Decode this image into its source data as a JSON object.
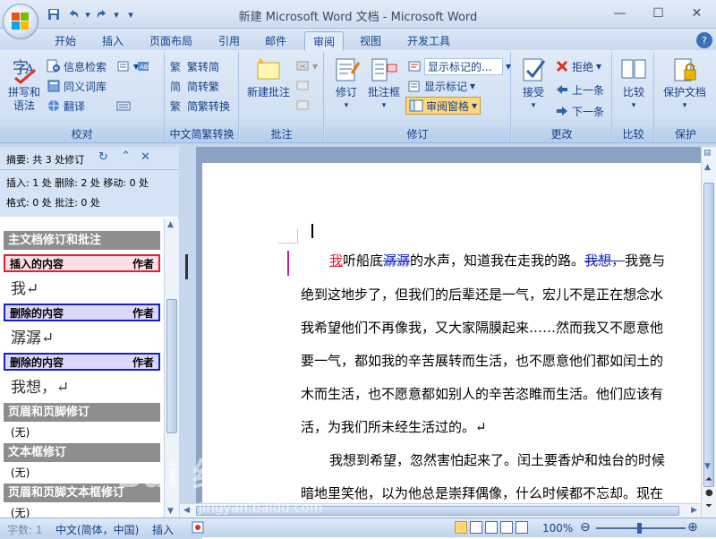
{
  "window": {
    "title": "新建 Microsoft Word 文档 - Microsoft Word",
    "quick_access": [
      "save-icon",
      "undo-icon",
      "redo-icon",
      "customize-icon"
    ]
  },
  "tabs": [
    {
      "label": "开始"
    },
    {
      "label": "插入"
    },
    {
      "label": "页面布局"
    },
    {
      "label": "引用"
    },
    {
      "label": "邮件"
    },
    {
      "label": "审阅",
      "active": true
    },
    {
      "label": "视图"
    },
    {
      "label": "开发工具"
    }
  ],
  "ribbon": {
    "proofing": {
      "label": "校对",
      "spell_check": "拼写和\n语法",
      "research": "信息检索",
      "thesaurus": "同义词库",
      "translate": "翻译"
    },
    "chinese_conversion": {
      "label": "中文简繁转换",
      "to_traditional": "繁转简",
      "to_simplified": "简转繁",
      "conversion": "简繁转换"
    },
    "comments": {
      "label": "批注",
      "new_comment": "新建批注"
    },
    "tracking": {
      "label": "修订",
      "track_changes": "修订",
      "balloons": "批注框",
      "display_for_review": "显示标记的...",
      "show_markup": "显示标记",
      "reviewing_pane": "审阅窗格"
    },
    "changes": {
      "label": "更改",
      "accept": "接受",
      "reject": "拒绝",
      "previous": "上一条",
      "next": "下一条"
    },
    "compare": {
      "label": "比较",
      "compare": "比较"
    },
    "protect": {
      "label": "保护",
      "protect_document": "保护文档"
    }
  },
  "pane": {
    "summary": "摘要: 共 3 处修订",
    "stats_line1": "插入: 1 处  删除: 2 处  移动: 0 处",
    "stats_line2": "格式: 0 处  批注: 0 处",
    "main_section": "主文档修订和批注",
    "revisions": [
      {
        "type": "插入的内容",
        "author": "作者",
        "text": "我↵"
      },
      {
        "type": "删除的内容",
        "author": "作者",
        "text": "潺潺↵"
      },
      {
        "type": "删除的内容",
        "author": "作者",
        "text": "我想，↵"
      }
    ],
    "header_footer": "页眉和页脚修订",
    "header_footer_value": "(无)",
    "textbox": "文本框修订",
    "textbox_value": "(无)",
    "header_footer_textbox": "页眉和页脚文本框修订",
    "header_footer_textbox_value": "(无)"
  },
  "document": {
    "line1_ins": "我",
    "line1_a": "听船底",
    "line1_del": "潺潺",
    "line1_b": "的水声，知道我在走我的路。",
    "line1_del2": "我想，",
    "line1_c": "我竟与",
    "line2": "绝到这地步了，但我们的后辈还是一气，宏儿不是正在想念水",
    "line3": "我希望他们不再像我，又大家隔膜起来……然而我又不愿意他",
    "line4": "要一气，都如我的辛苦展转而生活，也不愿意他们都如闰土的",
    "line5": "木而生活，也不愿意都如别人的辛苦恣睢而生活。他们应该有",
    "line6": "活，为我们所未经生活过的。↵",
    "line7": "我想到希望，忽然害怕起来了。闰土要香炉和烛台的时候",
    "line8": "暗地里笑他，以为他总是崇拜偶像，什么时候都不忘却。现在"
  },
  "status": {
    "words": "字数: 1",
    "language": "中文(简体，中国)",
    "insert_mode": "插入",
    "zoom": "100%"
  },
  "watermark": {
    "logo_text": "Bai 经验",
    "url": "jingyan.baidu.com"
  }
}
